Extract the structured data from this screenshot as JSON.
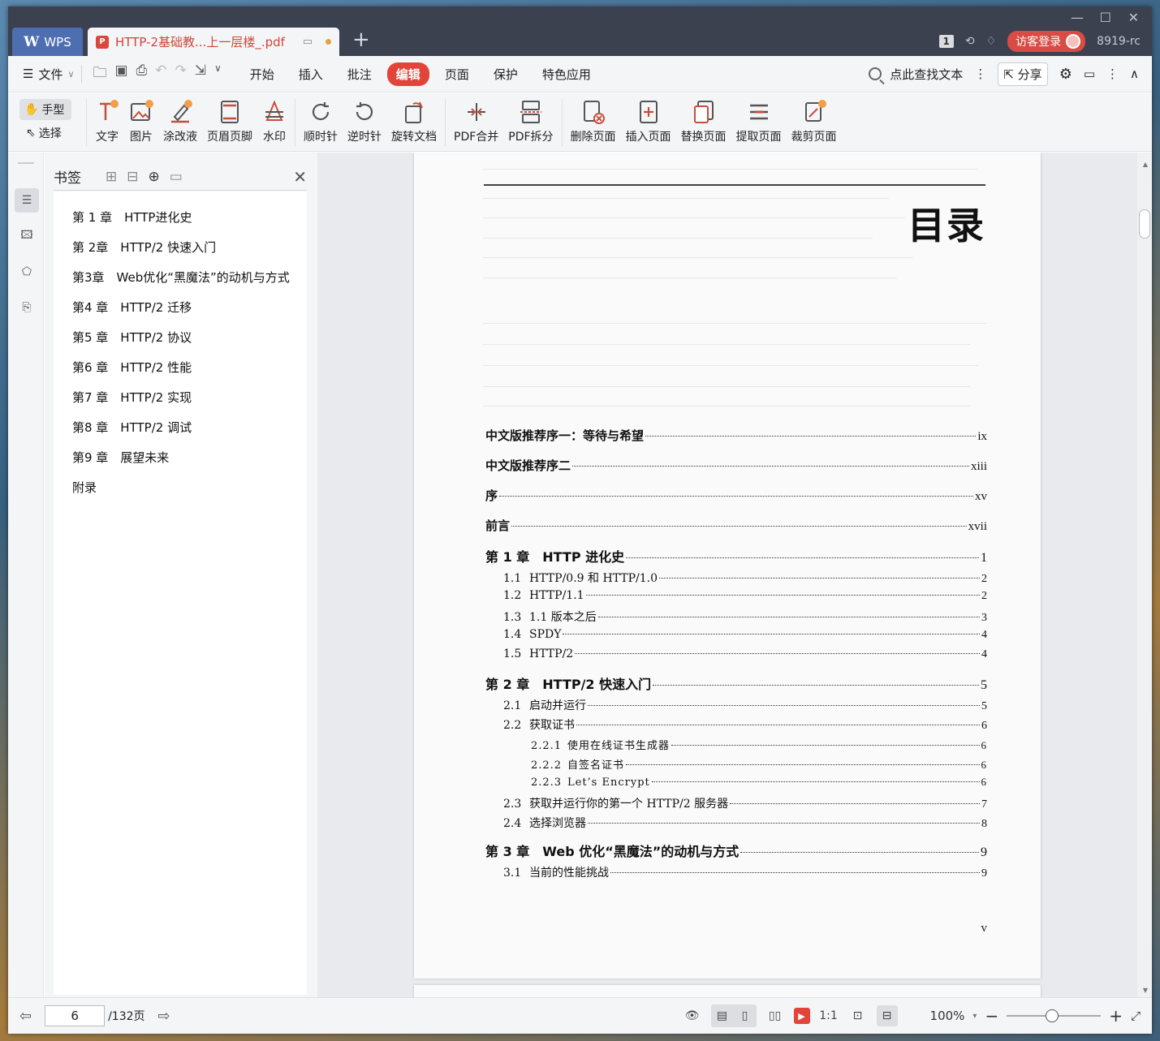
{
  "titlebar": {
    "app_tab": "WPS",
    "doc_tab": "HTTP-2基础教...上一层楼_.pdf",
    "page_badge": "1",
    "login_label": "访客登录",
    "user_id": "8919-rc"
  },
  "menubar": {
    "file_label": "文件",
    "tabs": [
      "开始",
      "插入",
      "批注",
      "编辑",
      "页面",
      "保护",
      "特色应用"
    ],
    "active_tab": "编辑",
    "search_label": "点此查找文本",
    "share_label": "分享"
  },
  "ribbon": {
    "hand_label": "手型",
    "select_label": "选择",
    "tools": [
      "文字",
      "图片",
      "涂改液",
      "页眉页脚",
      "水印",
      "顺时针",
      "逆时针",
      "旋转文档",
      "PDF合并",
      "PDF拆分",
      "删除页面",
      "插入页面",
      "替换页面",
      "提取页面",
      "裁剪页面"
    ]
  },
  "bookmarks": {
    "title": "书签",
    "items": [
      "第 1 章　HTTP进化史",
      "第 2章　HTTP/2 快速入门",
      "第3章　Web优化“黑魔法”的动机与方式",
      "第4 章　HTTP/2 迁移",
      "第5 章　HTTP/2 协议",
      "第6 章　HTTP/2 性能",
      "第7 章　HTTP/2 实现",
      "第8 章　HTTP/2 调试",
      "第9 章　展望未来",
      "附录"
    ]
  },
  "document": {
    "heading": "目录",
    "entries": [
      {
        "level": "l0",
        "num": "",
        "label": "中文版推荐序一：等待与希望",
        "page": "ix"
      },
      {
        "level": "l0",
        "num": "",
        "label": "中文版推荐序二",
        "page": "xiii"
      },
      {
        "level": "l0",
        "num": "",
        "label": "序",
        "page": "xv"
      },
      {
        "level": "l0",
        "num": "",
        "label": "前言",
        "page": "xvii"
      },
      {
        "level": "ch",
        "num": "",
        "label": "第 1 章　HTTP 进化史",
        "page": "1"
      },
      {
        "level": "l1",
        "num": "1.1",
        "label": "HTTP/0.9 和 HTTP/1.0",
        "page": "2"
      },
      {
        "level": "l1",
        "num": "1.2",
        "label": "HTTP/1.1",
        "page": "2"
      },
      {
        "level": "l1",
        "num": "1.3",
        "label": "1.1 版本之后",
        "page": "3"
      },
      {
        "level": "l1",
        "num": "1.4",
        "label": "SPDY",
        "page": "4"
      },
      {
        "level": "l1",
        "num": "1.5",
        "label": "HTTP/2",
        "page": "4"
      },
      {
        "level": "ch",
        "num": "",
        "label": "第 2 章　HTTP/2 快速入门",
        "page": "5"
      },
      {
        "level": "l1",
        "num": "2.1",
        "label": "启动并运行",
        "page": "5"
      },
      {
        "level": "l1",
        "num": "2.2",
        "label": "获取证书",
        "page": "6"
      },
      {
        "level": "l2",
        "num": "2.2.1",
        "label": "使用在线证书生成器",
        "page": "6"
      },
      {
        "level": "l2",
        "num": "2.2.2",
        "label": "自签名证书",
        "page": "6"
      },
      {
        "level": "l2",
        "num": "2.2.3",
        "label": "Let’s Encrypt",
        "page": "6"
      },
      {
        "level": "l1",
        "num": "2.3",
        "label": "获取并运行你的第一个 HTTP/2 服务器",
        "page": "7"
      },
      {
        "level": "l1",
        "num": "2.4",
        "label": "选择浏览器",
        "page": "8"
      },
      {
        "level": "ch",
        "num": "",
        "label": "第 3 章　Web 优化“黑魔法”的动机与方式",
        "page": "9"
      },
      {
        "level": "l1",
        "num": "3.1",
        "label": "当前的性能挑战",
        "page": "9"
      }
    ],
    "page_footer": "v"
  },
  "statusbar": {
    "current_page": "6",
    "total_pages": "/132页",
    "zoom": "100%"
  },
  "colors": {
    "accent": "#e2443a",
    "titlebar": "#3c4150",
    "wps_blue": "#4d6fb1"
  }
}
